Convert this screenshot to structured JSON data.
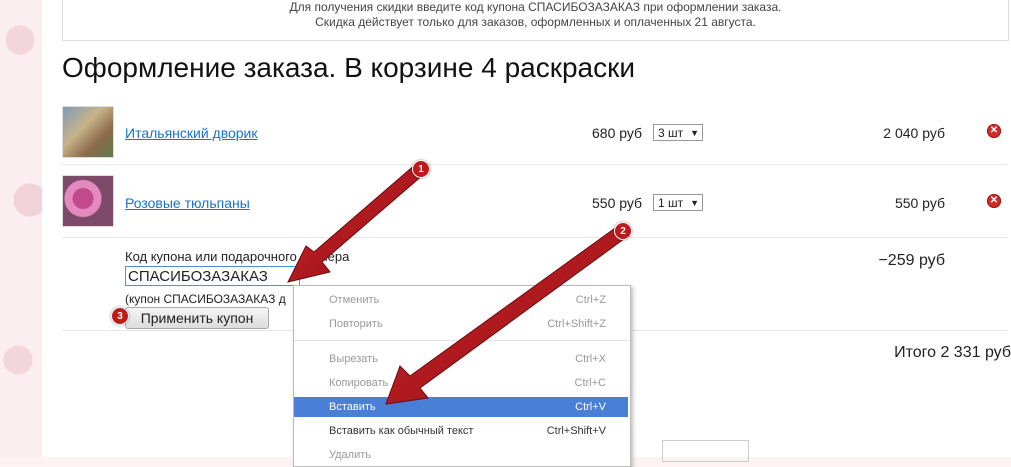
{
  "notice": {
    "line1": "Для получения скидки введите код купона СПАСИБОЗАЗАКАЗ при оформлении заказа.",
    "line2": "Скидка действует только для заказов, оформленных и оплаченных 21 августа."
  },
  "title": "Оформление заказа. В корзине 4 раскраски",
  "items": [
    {
      "name": "Итальянский дворик",
      "price": "680 руб",
      "qty": "3 шт",
      "total": "2 040 руб"
    },
    {
      "name": "Розовые тюльпаны",
      "price": "550 руб",
      "qty": "1 шт",
      "total": "550 руб"
    }
  ],
  "coupon": {
    "label": "Код купона или подарочного ваучера",
    "value": "СПАСИБОЗАЗАКАЗ",
    "hint": "(купон СПАСИБОЗАЗАКАЗ д",
    "apply_label": "Применить купон",
    "discount": "−259 руб"
  },
  "grand_total": "Итого 2 331 руб",
  "context_menu": {
    "items": [
      {
        "label": "Отменить",
        "shortcut": "Ctrl+Z",
        "state": "disabled"
      },
      {
        "label": "Повторить",
        "shortcut": "Ctrl+Shift+Z",
        "state": "disabled"
      },
      {
        "label": "Вырезать",
        "shortcut": "Ctrl+X",
        "state": "disabled"
      },
      {
        "label": "Копировать",
        "shortcut": "Ctrl+C",
        "state": "disabled"
      },
      {
        "label": "Вставить",
        "shortcut": "Ctrl+V",
        "state": "highlighted"
      },
      {
        "label": "Вставить как обычный текст",
        "shortcut": "Ctrl+Shift+V",
        "state": "enabled"
      },
      {
        "label": "Удалить",
        "shortcut": "",
        "state": "disabled"
      }
    ]
  },
  "annotations": {
    "badge1": "1",
    "badge2": "2",
    "badge3": "3",
    "arrow_color": "#b0141b"
  },
  "icons": {
    "remove": "remove-icon",
    "qty_dropdown": "chevron-down-icon"
  }
}
